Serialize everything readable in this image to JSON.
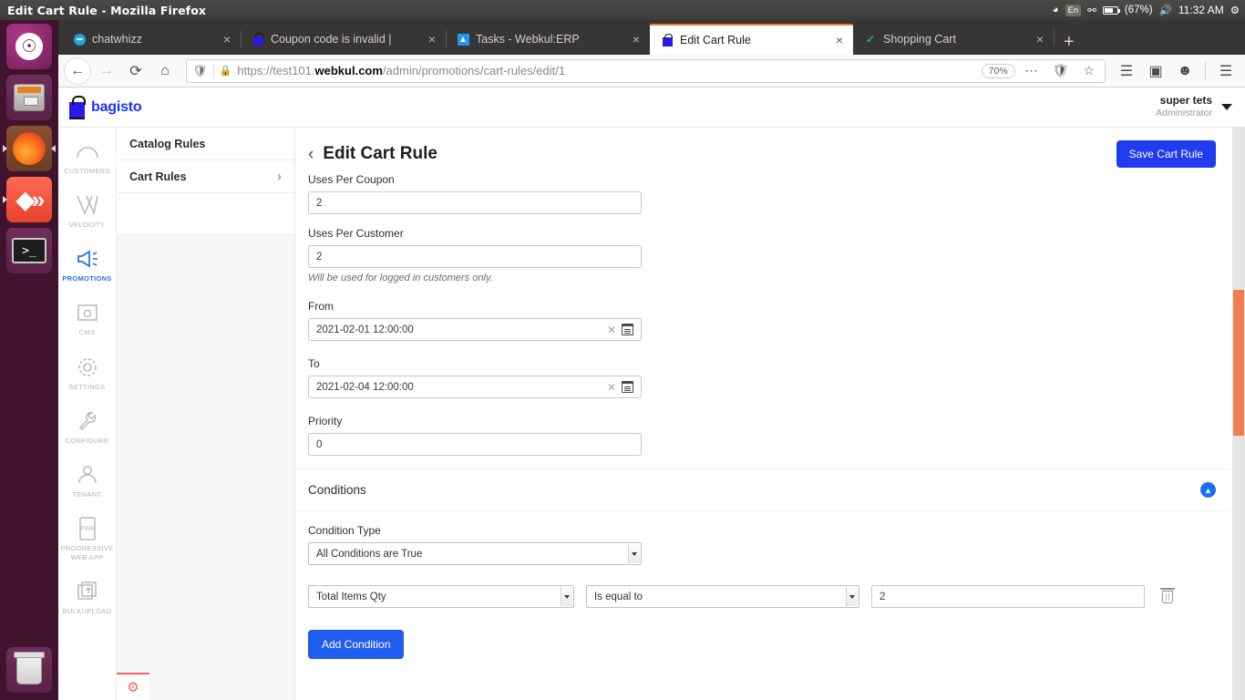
{
  "os": {
    "window_title": "Edit Cart Rule - Mozilla Firefox",
    "tray": {
      "wifi_icon": "wifi-icon",
      "language": "En",
      "bluetooth_icon": "bluetooth-icon",
      "battery_text": "(67%)",
      "volume_icon": "volume-icon",
      "clock": "11:32 AM",
      "settings_icon": "gear-icon"
    },
    "launcher": [
      {
        "name": "ubuntu-dash-icon",
        "label": "Ubuntu Dash"
      },
      {
        "name": "files-icon",
        "label": "Files"
      },
      {
        "name": "firefox-icon",
        "label": "Firefox"
      },
      {
        "name": "velocity-icon",
        "label": "Velocity"
      },
      {
        "name": "terminal-icon",
        "label": "Terminal"
      },
      {
        "name": "trash-icon",
        "label": "Trash"
      }
    ]
  },
  "browser": {
    "tabs": [
      {
        "title": "chatwhizz",
        "favicon": "chat-icon",
        "active": false
      },
      {
        "title": "Coupon code is invalid | ",
        "favicon": "bag-icon",
        "active": false
      },
      {
        "title": "Tasks - Webkul:ERP",
        "favicon": "tasks-icon",
        "active": false
      },
      {
        "title": "Edit Cart Rule",
        "favicon": "bag-icon",
        "active": true
      },
      {
        "title": "Shopping Cart",
        "favicon": "check-icon",
        "active": false
      }
    ],
    "new_tab_label": "+",
    "close_label": "×",
    "nav": {
      "back_icon": "back-arrow-icon",
      "forward_icon": "forward-arrow-icon",
      "reload_icon": "reload-icon",
      "home_icon": "home-icon"
    },
    "url": {
      "scheme": "https://",
      "domain_strong": "webkul.com",
      "domain_prefix": "test101.",
      "path": "/admin/promotions/cart-rules/edit/1",
      "zoom_level": "70%"
    },
    "toolbar_right": [
      "library-icon",
      "sidebar-icon",
      "account-icon",
      "menu-icon"
    ]
  },
  "app": {
    "brand": "bagisto",
    "user": {
      "name": "super tets",
      "role": "Administrator"
    },
    "sidenav": [
      {
        "label": "CUSTOMERS",
        "icon": "customers-icon",
        "active": false
      },
      {
        "label": "VELOCITY",
        "icon": "velocity-icon",
        "active": false
      },
      {
        "label": "PROMOTIONS",
        "icon": "megaphone-icon",
        "active": true
      },
      {
        "label": "CMS",
        "icon": "cms-icon",
        "active": false
      },
      {
        "label": "SETTINGS",
        "icon": "gear-icon",
        "active": false
      },
      {
        "label": "CONFIGURE",
        "icon": "wrench-icon",
        "active": false
      },
      {
        "label": "TENANT",
        "icon": "user-icon",
        "active": false
      },
      {
        "label": "PROGRESSIVE WEB APP",
        "icon": "pwa-icon",
        "active": false
      },
      {
        "label": "BULKUPLOAD",
        "icon": "upload-icon",
        "active": false
      }
    ],
    "subnav": [
      {
        "label": "Catalog Rules",
        "has_chevron": false
      },
      {
        "label": "Cart Rules",
        "has_chevron": true
      }
    ],
    "page_title": "Edit Cart Rule",
    "save_button": "Save Cart Rule",
    "form": {
      "uses_per_coupon": {
        "label": "Uses Per Coupon",
        "value": "2"
      },
      "uses_per_customer": {
        "label": "Uses Per Customer",
        "value": "2",
        "note": "Will be used for logged in customers only."
      },
      "from": {
        "label": "From",
        "value": "2021-02-01 12:00:00"
      },
      "to": {
        "label": "To",
        "value": "2021-02-04 12:00:00"
      },
      "priority": {
        "label": "Priority",
        "value": "0"
      }
    },
    "conditions": {
      "section_title": "Conditions",
      "condition_type": {
        "label": "Condition Type",
        "value": "All Conditions are True"
      },
      "rows": [
        {
          "attribute": "Total Items Qty",
          "operator": "Is equal to",
          "value": "2"
        }
      ],
      "add_button": "Add Condition"
    }
  }
}
